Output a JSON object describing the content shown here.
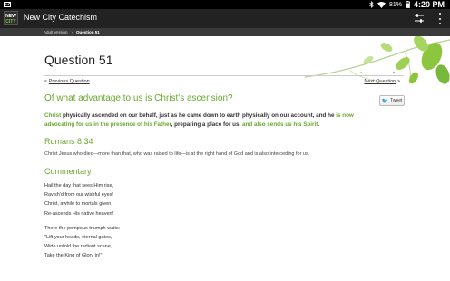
{
  "status_bar": {
    "battery_pct": "81%",
    "time": "4:20 PM",
    "icons": [
      "mail-icon",
      "bluetooth-icon",
      "wifi-icon",
      "battery-icon"
    ]
  },
  "app_bar": {
    "logo_line1": "NEW",
    "logo_line2": "CITY",
    "title": "New City Catechism",
    "icons": [
      "settings-sliders-icon",
      "overflow-menu-icon"
    ]
  },
  "breadcrumb": {
    "items": [
      "Adult Version",
      "Question 51"
    ]
  },
  "question": {
    "title": "Question 51",
    "prev_label": "Previous Question",
    "next_label": "Next Question",
    "text": "Of what advantage to us is Christ's ascension?",
    "tweet_label": "Tweet",
    "answer": {
      "p1": "Christ",
      "p2": " physically ascended on our behalf, just as he came down to earth physically on our account, and he ",
      "p3": "is now advocating for us in the presence of his Father",
      "p4": ", preparing a place for us, ",
      "p5": "and also sends us his Spirit",
      "p6": "."
    }
  },
  "verse": {
    "ref": "Romans 8:34",
    "text": "Christ Jesus who died—more than that, who was raised to life—is at the right hand of God and is also interceding for us."
  },
  "commentary": {
    "heading": "Commentary",
    "stanza1": [
      "Hail the day that sees Him rise,",
      "Ravish'd from our wishful eyes!",
      "Christ, awhile to mortals given,",
      "Re-ascends His native heaven!"
    ],
    "stanza2": [
      "There the pompous triumph waits:",
      "\"Lift your heads, eternal gates,",
      "Wide unfold the radiant scene,",
      "Take the King of Glory in!\""
    ]
  },
  "colors": {
    "accent_green": "#6aa82f",
    "appbar": "#222222"
  }
}
